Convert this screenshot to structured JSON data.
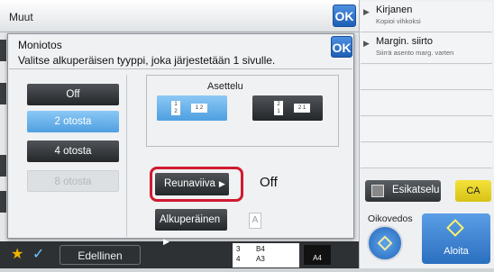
{
  "background": {
    "title": "Muut",
    "ok_label": "OK"
  },
  "right_panel": {
    "items": [
      {
        "title": "Kirjanen",
        "subtitle": "Kopioi vihkoksi"
      },
      {
        "title": "Margin. siirto",
        "subtitle": "Siirrä asento marg. varten"
      }
    ],
    "preview_label": "Esikatselu",
    "ca_label": "CA",
    "copies_label": "Oikovedos",
    "start_label": "Aloita"
  },
  "bottom_bar": {
    "prev_label": "Edellinen",
    "tray_rows": [
      {
        "num": "3",
        "size": "B4"
      },
      {
        "num": "4",
        "size": "A3"
      }
    ],
    "tray_size": "A4"
  },
  "modal": {
    "title": "Moniotos",
    "subtitle": "Valitse alkuperäisen tyyppi, joka järjestetään 1 sivulle.",
    "ok_label": "OK",
    "page_options": [
      {
        "label": "Off",
        "state": "normal"
      },
      {
        "label": "2 otosta",
        "state": "selected"
      },
      {
        "label": "4 otosta",
        "state": "normal"
      },
      {
        "label": "8 otosta",
        "state": "disabled"
      }
    ],
    "layout_label": "Asettelu",
    "layout_1": {
      "p1": "1",
      "p2": "2",
      "merged": "1 2"
    },
    "layout_2": {
      "p1": "2",
      "p2": "1",
      "merged": "2 1"
    },
    "border_label": "Reunaviiva",
    "border_value": "Off",
    "original_label": "Alkuperäinen",
    "original_icon": "A"
  }
}
